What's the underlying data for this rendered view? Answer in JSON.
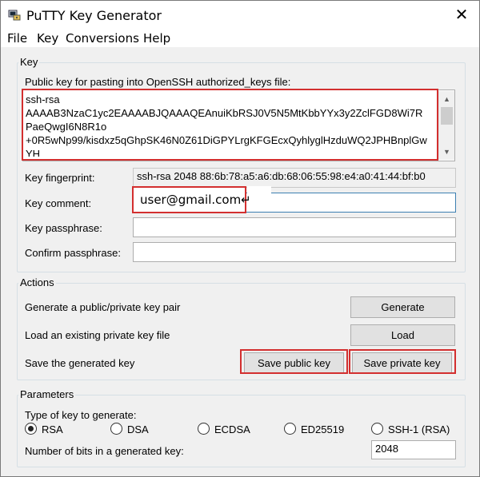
{
  "window": {
    "title": "PuTTY Key Generator",
    "close_glyph": "✕"
  },
  "menu": {
    "items": [
      "File",
      "Key",
      "Conversions",
      "Help"
    ]
  },
  "key_group": {
    "label": "Key",
    "public_key_label": "Public key for pasting into OpenSSH authorized_keys file:",
    "public_key_text": "ssh-rsa\nAAAAB3NzaC1yc2EAAAABJQAAAQEAnuiKbRSJ0V5N5MtKbbYYx3y2ZclFGD8Wi7R\nPaeQwgI6N8R1o\n+0R5wNp99/kisdxz5qGhpSK46N0Z61DiGPYLrgKFGEcxQyhlyglHzduWQ2JPHBnplGw\nYH",
    "fingerprint_label": "Key fingerprint:",
    "fingerprint_value": "ssh-rsa 2048 88:6b:78:a5:a6:db:68:06:55:98:e4:a0:41:44:bf:b0",
    "comment_label": "Key comment:",
    "comment_value": "user@gmail.com↵",
    "passphrase_label": "Key passphrase:",
    "confirm_label": "Confirm passphrase:"
  },
  "actions_group": {
    "label": "Actions",
    "generate_desc": "Generate a public/private key pair",
    "generate_btn": "Generate",
    "load_desc": "Load an existing private key file",
    "load_btn": "Load",
    "save_desc": "Save the generated key",
    "save_public_btn": "Save public key",
    "save_private_btn": "Save private key"
  },
  "params_group": {
    "label": "Parameters",
    "type_label": "Type of key to generate:",
    "types": [
      "RSA",
      "DSA",
      "ECDSA",
      "ED25519",
      "SSH-1 (RSA)"
    ],
    "selected_type": "RSA",
    "bits_label": "Number of bits in a generated key:",
    "bits_value": "2048"
  },
  "highlight_color": "#d32f2f"
}
